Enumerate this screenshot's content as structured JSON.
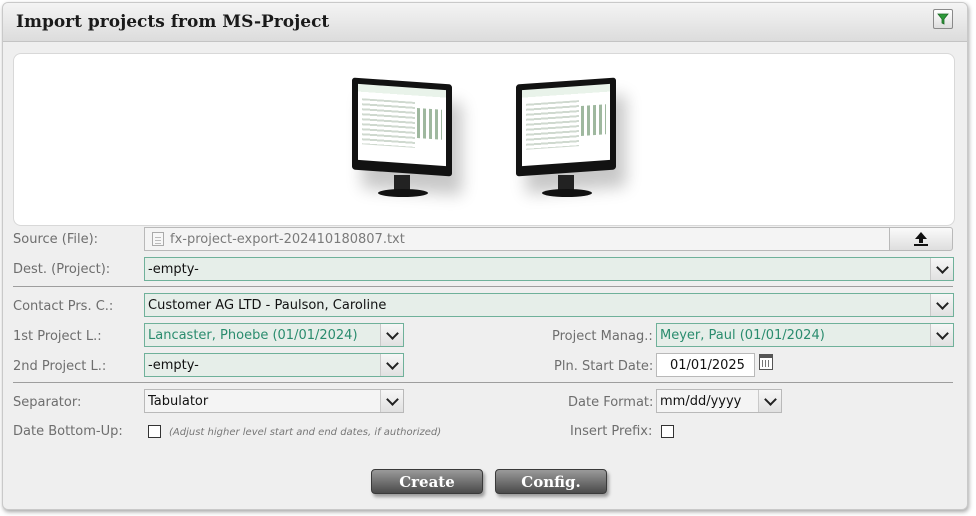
{
  "dialog": {
    "title": "Import projects from MS-Project"
  },
  "labels": {
    "source": "Source (File):",
    "dest": "Dest. (Project):",
    "contact": "Contact Prs. C.:",
    "project_lead1": "1st Project L.:",
    "project_lead2": "2nd Project L.:",
    "project_manager": "Project Manag.:",
    "planned_start": "Pln. Start Date:",
    "separator": "Separator:",
    "date_format": "Date Format:",
    "date_bottom_up": "Date Bottom-Up:",
    "insert_prefix": "Insert Prefix:"
  },
  "values": {
    "source_file": "fx-project-export-202410180807.txt",
    "dest": "-empty-",
    "contact": "Customer AG LTD - Paulson, Caroline",
    "project_lead1": "Lancaster, Phoebe (01/01/2024)",
    "project_lead2": "-empty-",
    "project_manager": "Meyer, Paul (01/01/2024)",
    "planned_start": "01/01/2025",
    "separator": "Tabulator",
    "date_format": "mm/dd/yyyy"
  },
  "hints": {
    "date_bottom_up": "(Adjust higher level start and end dates, if authorized)"
  },
  "buttons": {
    "create": "Create",
    "config": "Config."
  },
  "icons": {
    "filter": "filter-icon",
    "upload": "upload-icon",
    "file": "file-icon",
    "calendar": "calendar-icon"
  },
  "colors": {
    "accent_teal": "#2a8c6e",
    "field_border_green": "#6fb19a"
  }
}
